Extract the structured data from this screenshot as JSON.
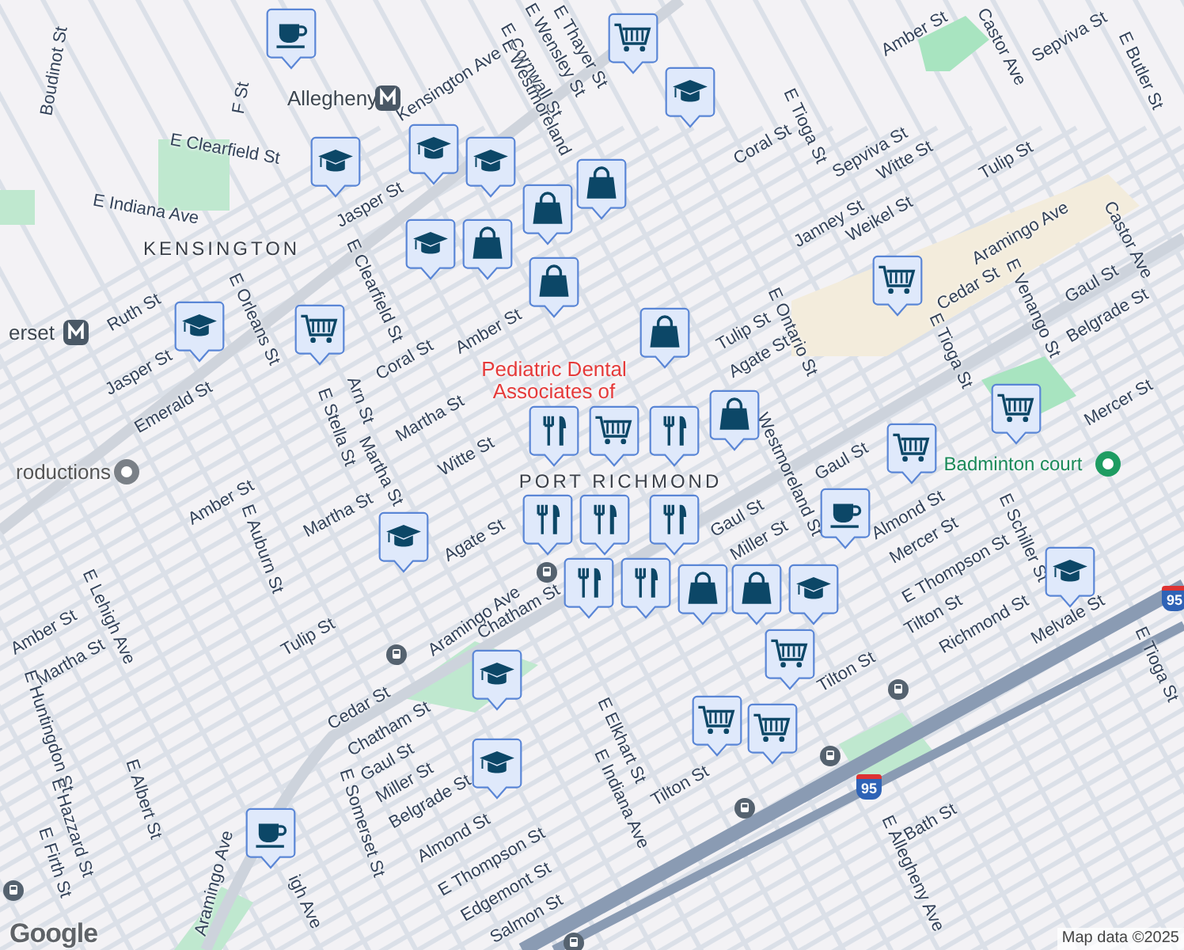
{
  "map": {
    "labels": [
      {
        "text": "Kensington Ave",
        "kind": "street"
      },
      {
        "text": "E Thayer St",
        "kind": "street"
      },
      {
        "text": "E Wensley St",
        "kind": "street"
      },
      {
        "text": "E Cornwall St",
        "kind": "street"
      },
      {
        "text": "E Westmoreland",
        "kind": "street"
      },
      {
        "text": "Amber St",
        "kind": "street"
      },
      {
        "text": "Castor Ave",
        "kind": "street"
      },
      {
        "text": "Sepviva St",
        "kind": "street"
      },
      {
        "text": "E Butler St",
        "kind": "street"
      },
      {
        "text": "Coral St",
        "kind": "street"
      },
      {
        "text": "E Tioga St",
        "kind": "street"
      },
      {
        "text": "Sepviva St",
        "kind": "street"
      },
      {
        "text": "Witte St",
        "kind": "street"
      },
      {
        "text": "Tulip St",
        "kind": "street"
      },
      {
        "text": "Janney St",
        "kind": "street"
      },
      {
        "text": "Weikel St",
        "kind": "street"
      },
      {
        "text": "Aramingo Ave",
        "kind": "street"
      },
      {
        "text": "Castor Ave",
        "kind": "street"
      },
      {
        "text": "E Ontario St",
        "kind": "street"
      },
      {
        "text": "Tulip St",
        "kind": "street"
      },
      {
        "text": "Agate St",
        "kind": "street"
      },
      {
        "text": "Cedar St",
        "kind": "street"
      },
      {
        "text": "E Venango St",
        "kind": "street"
      },
      {
        "text": "E Tioga St",
        "kind": "street"
      },
      {
        "text": "Gaul St",
        "kind": "street"
      },
      {
        "text": "Belgrade St",
        "kind": "street"
      },
      {
        "text": "Mercer St",
        "kind": "street"
      },
      {
        "text": "Gaul St",
        "kind": "street"
      },
      {
        "text": "Badminton court",
        "kind": "park"
      },
      {
        "text": "Pediatric Dental Associates of",
        "kind": "place"
      },
      {
        "text": "PORT RICHMOND",
        "kind": "district"
      },
      {
        "text": "KENSINGTON",
        "kind": "district"
      },
      {
        "text": "Allegheny",
        "kind": "station"
      },
      {
        "text": "erset",
        "kind": "station"
      },
      {
        "text": "roductions",
        "kind": "poi"
      },
      {
        "text": "Boudinot St",
        "kind": "street"
      },
      {
        "text": "F St",
        "kind": "street"
      },
      {
        "text": "E Clearfield St",
        "kind": "street"
      },
      {
        "text": "E Indiana Ave",
        "kind": "street"
      },
      {
        "text": "E Clearfield St",
        "kind": "street"
      },
      {
        "text": "Jasper St",
        "kind": "street"
      },
      {
        "text": "Ruth St",
        "kind": "street"
      },
      {
        "text": "E Orleans St",
        "kind": "street"
      },
      {
        "text": "Jasper St",
        "kind": "street"
      },
      {
        "text": "Emerald St",
        "kind": "street"
      },
      {
        "text": "Coral St",
        "kind": "street"
      },
      {
        "text": "Amber St",
        "kind": "street"
      },
      {
        "text": "Arn St",
        "kind": "street"
      },
      {
        "text": "E Stella St",
        "kind": "street"
      },
      {
        "text": "Martha St",
        "kind": "street"
      },
      {
        "text": "Witte St",
        "kind": "street"
      },
      {
        "text": "Martha St",
        "kind": "street"
      },
      {
        "text": "Amber St",
        "kind": "street"
      },
      {
        "text": "E Auburn St",
        "kind": "street"
      },
      {
        "text": "Martha St",
        "kind": "street"
      },
      {
        "text": "Agate St",
        "kind": "street"
      },
      {
        "text": "Aramingo Ave",
        "kind": "street"
      },
      {
        "text": "Tulip St",
        "kind": "street"
      },
      {
        "text": "E Lehigh Ave",
        "kind": "street"
      },
      {
        "text": "Amber St",
        "kind": "street"
      },
      {
        "text": "Martha St",
        "kind": "street"
      },
      {
        "text": "E Huntingdon St",
        "kind": "street"
      },
      {
        "text": "E Hazzard St",
        "kind": "street"
      },
      {
        "text": "E Albert St",
        "kind": "street"
      },
      {
        "text": "E Firth St",
        "kind": "street"
      },
      {
        "text": "Cedar St",
        "kind": "street"
      },
      {
        "text": "Chatham St",
        "kind": "street"
      },
      {
        "text": "Chatham St",
        "kind": "street"
      },
      {
        "text": "Gaul St",
        "kind": "street"
      },
      {
        "text": "Miller St",
        "kind": "street"
      },
      {
        "text": "Belgrade St",
        "kind": "street"
      },
      {
        "text": "E Somerset St",
        "kind": "street"
      },
      {
        "text": "Almond St",
        "kind": "street"
      },
      {
        "text": "E Thompson St",
        "kind": "street"
      },
      {
        "text": "Edgemont St",
        "kind": "street"
      },
      {
        "text": "Salmon St",
        "kind": "street"
      },
      {
        "text": "Aramingo Ave",
        "kind": "street"
      },
      {
        "text": "igh Ave",
        "kind": "street"
      },
      {
        "text": "E Elkhart St",
        "kind": "street"
      },
      {
        "text": "E Indiana Ave",
        "kind": "street"
      },
      {
        "text": "Tilton St",
        "kind": "street"
      },
      {
        "text": "Gaul St",
        "kind": "street"
      },
      {
        "text": "Miller St",
        "kind": "street"
      },
      {
        "text": "Westmoreland St",
        "kind": "street"
      },
      {
        "text": "Almond St",
        "kind": "street"
      },
      {
        "text": "Mercer St",
        "kind": "street"
      },
      {
        "text": "E Thompson St",
        "kind": "street"
      },
      {
        "text": "E Schiller St",
        "kind": "street"
      },
      {
        "text": "Tilton St",
        "kind": "street"
      },
      {
        "text": "Richmond St",
        "kind": "street"
      },
      {
        "text": "Melvale St",
        "kind": "street"
      },
      {
        "text": "E Tioga St",
        "kind": "street"
      },
      {
        "text": "Tilton St",
        "kind": "street"
      },
      {
        "text": "Bath St",
        "kind": "street"
      },
      {
        "text": "E Allegheny Ave",
        "kind": "street"
      },
      {
        "text": "95",
        "kind": "highway"
      },
      {
        "text": "95",
        "kind": "highway"
      }
    ],
    "pins": [
      {
        "kind": "coffee"
      },
      {
        "kind": "cart"
      },
      {
        "kind": "school"
      },
      {
        "kind": "school"
      },
      {
        "kind": "school"
      },
      {
        "kind": "school"
      },
      {
        "kind": "bag"
      },
      {
        "kind": "bag"
      },
      {
        "kind": "school"
      },
      {
        "kind": "bag"
      },
      {
        "kind": "bag"
      },
      {
        "kind": "cart"
      },
      {
        "kind": "school"
      },
      {
        "kind": "bag"
      },
      {
        "kind": "cart"
      },
      {
        "kind": "cart"
      },
      {
        "kind": "food"
      },
      {
        "kind": "food"
      },
      {
        "kind": "food"
      },
      {
        "kind": "bag"
      },
      {
        "kind": "food"
      },
      {
        "kind": "food"
      },
      {
        "kind": "cart"
      },
      {
        "kind": "cart"
      },
      {
        "kind": "coffee"
      },
      {
        "kind": "school"
      },
      {
        "kind": "food"
      },
      {
        "kind": "food"
      },
      {
        "kind": "bag"
      },
      {
        "kind": "bag"
      },
      {
        "kind": "school"
      },
      {
        "kind": "school"
      },
      {
        "kind": "cart"
      },
      {
        "kind": "cart"
      },
      {
        "kind": "cart"
      },
      {
        "kind": "school"
      },
      {
        "kind": "school"
      },
      {
        "kind": "coffee"
      }
    ],
    "logo": "Google",
    "attribution": "Map data ©2025"
  }
}
